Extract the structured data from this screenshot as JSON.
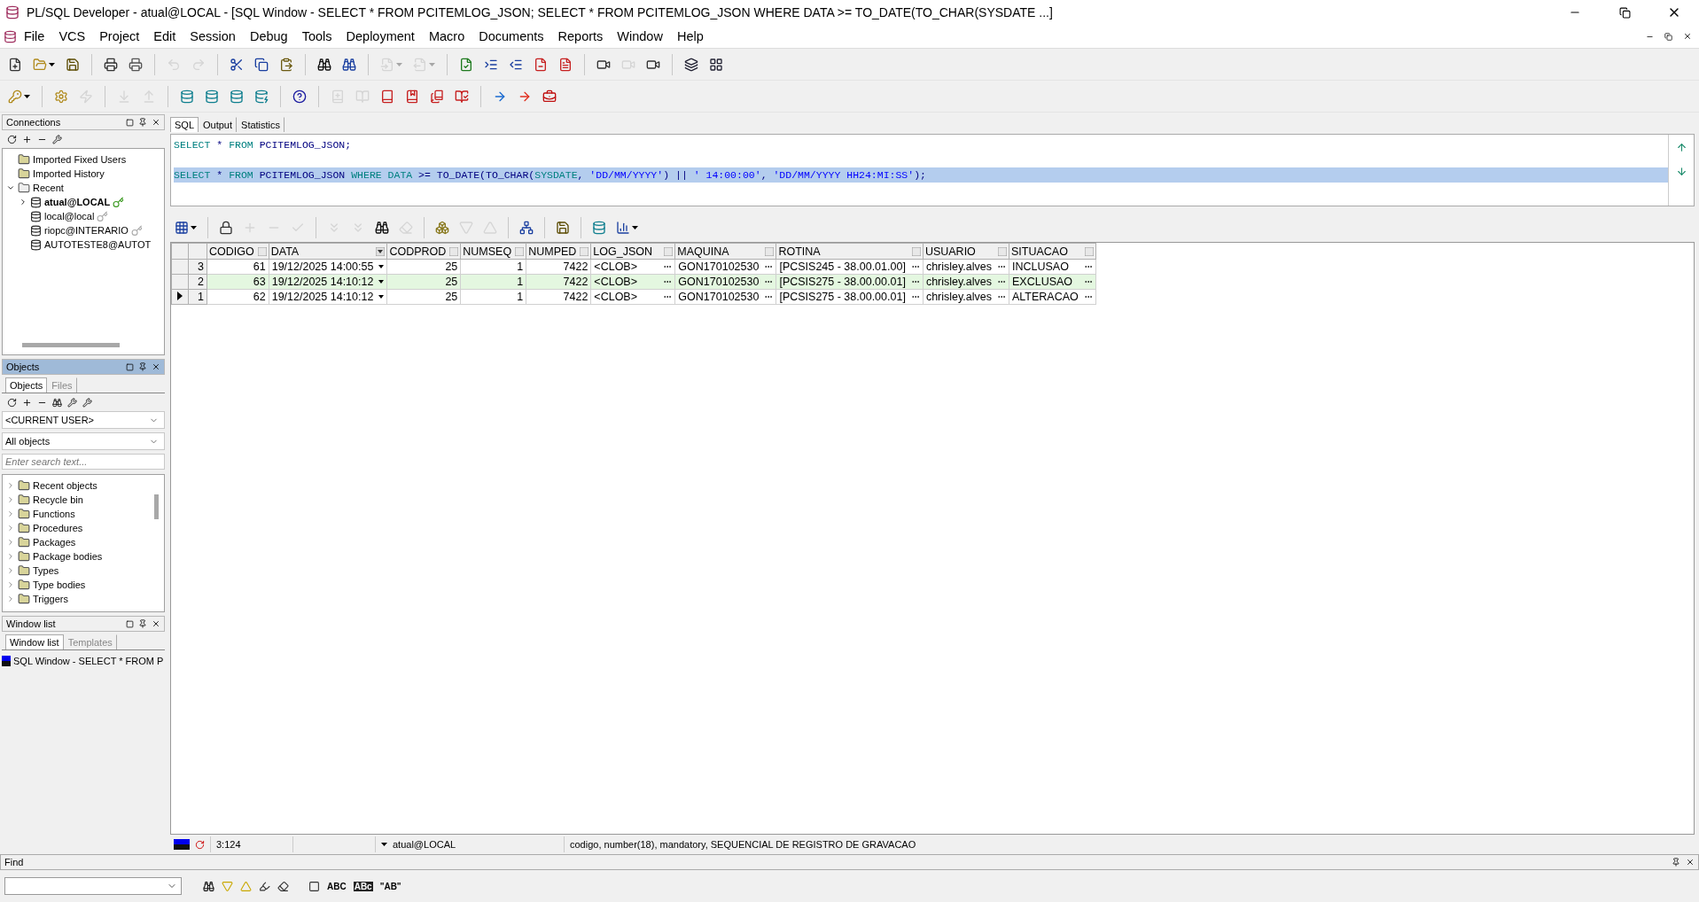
{
  "window": {
    "title": "PL/SQL Developer - atual@LOCAL - [SQL Window - SELECT * FROM PCITEMLOG_JSON; SELECT * FROM PCITEMLOG_JSON WHERE DATA >= TO_DATE(TO_CHAR(SYSDATE ...]"
  },
  "menu": [
    "File",
    "VCS",
    "Project",
    "Edit",
    "Session",
    "Debug",
    "Tools",
    "Deployment",
    "Macro",
    "Documents",
    "Reports",
    "Window",
    "Help"
  ],
  "toolbar_1": [
    {
      "kind": "new",
      "disabled": false
    },
    {
      "kind": "open",
      "disabled": false,
      "dropdown": true
    },
    {
      "kind": "save",
      "disabled": false
    },
    {
      "kind": "sep"
    },
    {
      "kind": "print",
      "disabled": false
    },
    {
      "kind": "print-setup",
      "disabled": false
    },
    {
      "kind": "sep"
    },
    {
      "kind": "undo",
      "disabled": true
    },
    {
      "kind": "redo",
      "disabled": true
    },
    {
      "kind": "sep"
    },
    {
      "kind": "cut",
      "disabled": false
    },
    {
      "kind": "copy",
      "disabled": false
    },
    {
      "kind": "paste",
      "disabled": false
    },
    {
      "kind": "sep"
    },
    {
      "kind": "find",
      "disabled": false
    },
    {
      "kind": "find-next",
      "disabled": false
    },
    {
      "kind": "sep"
    },
    {
      "kind": "back",
      "disabled": true,
      "dropdown": true
    },
    {
      "kind": "forward",
      "disabled": true,
      "dropdown": true
    },
    {
      "kind": "sep"
    },
    {
      "kind": "check",
      "disabled": false
    },
    {
      "kind": "indent",
      "disabled": false
    },
    {
      "kind": "unindent",
      "disabled": false
    },
    {
      "kind": "comment",
      "disabled": false
    },
    {
      "kind": "uncomment",
      "disabled": false
    },
    {
      "kind": "sep"
    },
    {
      "kind": "record",
      "disabled": false
    },
    {
      "kind": "play",
      "disabled": true
    },
    {
      "kind": "macro",
      "disabled": false
    },
    {
      "kind": "sep"
    },
    {
      "kind": "windows",
      "disabled": false
    },
    {
      "kind": "layout",
      "disabled": false
    }
  ],
  "toolbar_2": [
    {
      "kind": "key",
      "disabled": false,
      "dropdown": true
    },
    {
      "kind": "sep"
    },
    {
      "kind": "gear",
      "disabled": false
    },
    {
      "kind": "break",
      "disabled": true
    },
    {
      "kind": "sep"
    },
    {
      "kind": "import",
      "disabled": true
    },
    {
      "kind": "export",
      "disabled": true
    },
    {
      "kind": "sep"
    },
    {
      "kind": "db-bulb",
      "disabled": false
    },
    {
      "kind": "db-sql",
      "disabled": false
    },
    {
      "kind": "db-find",
      "disabled": false
    },
    {
      "kind": "db-close",
      "disabled": false
    },
    {
      "kind": "sep"
    },
    {
      "kind": "help",
      "disabled": false
    },
    {
      "kind": "sep"
    },
    {
      "kind": "book-new",
      "disabled": true
    },
    {
      "kind": "book-open",
      "disabled": true
    },
    {
      "kind": "book",
      "disabled": false
    },
    {
      "kind": "book-folder",
      "disabled": false
    },
    {
      "kind": "book-copy",
      "disabled": false
    },
    {
      "kind": "book-edit",
      "disabled": false
    },
    {
      "kind": "sep"
    },
    {
      "kind": "arrow-blue",
      "disabled": false
    },
    {
      "kind": "arrow-red",
      "disabled": false
    },
    {
      "kind": "toolbox",
      "disabled": false
    }
  ],
  "connections": {
    "title": "Connections",
    "tools": [
      {
        "kind": "refresh"
      },
      {
        "kind": "add"
      },
      {
        "kind": "remove"
      },
      {
        "kind": "filter"
      }
    ],
    "tree": [
      {
        "kind": "folder",
        "label": "Imported Fixed Users"
      },
      {
        "kind": "folder",
        "label": "Imported History"
      },
      {
        "kind": "recent",
        "label": "Recent",
        "expanded": true,
        "children": [
          {
            "kind": "connection",
            "label": "atual@LOCAL",
            "expanded": false,
            "active": true
          },
          {
            "kind": "connection",
            "label": "local@local",
            "active": false
          },
          {
            "kind": "connection",
            "label": "riopc@INTERARIO",
            "active": false
          },
          {
            "kind": "connection",
            "label": "AUTOTESTE8@AUTOT"
          }
        ]
      }
    ]
  },
  "objects": {
    "title": "Objects",
    "tabs": [
      {
        "label": "Objects",
        "selected": true
      },
      {
        "label": "Files",
        "selected": false
      }
    ],
    "tools": [
      {
        "kind": "refresh"
      },
      {
        "kind": "add"
      },
      {
        "kind": "remove"
      },
      {
        "kind": "find"
      },
      {
        "kind": "tool"
      },
      {
        "kind": "filter"
      }
    ],
    "owner": "<CURRENT USER>",
    "filter": "All objects",
    "search": {
      "placeholder": "Enter search text..."
    },
    "tree": [
      {
        "label": "Recent objects",
        "expanded": false
      },
      {
        "label": "Recycle bin",
        "expanded": false
      },
      {
        "label": "Functions",
        "expanded": false
      },
      {
        "label": "Procedures",
        "expanded": false
      },
      {
        "label": "Packages",
        "expanded": false
      },
      {
        "label": "Package bodies",
        "expanded": false
      },
      {
        "label": "Types",
        "expanded": false
      },
      {
        "label": "Type bodies",
        "expanded": false
      },
      {
        "label": "Triggers",
        "expanded": false
      }
    ]
  },
  "window_list": {
    "title": "Window list",
    "tabs": [
      {
        "label": "Window list",
        "selected": true
      },
      {
        "label": "Templates",
        "selected": false
      }
    ],
    "items": [
      "SQL Window - SELECT * FROM P"
    ]
  },
  "sql_tabs": [
    {
      "label": "SQL",
      "selected": true
    },
    {
      "label": "Output",
      "selected": false
    },
    {
      "label": "Statistics",
      "selected": false
    }
  ],
  "editor": {
    "lines": [
      {
        "selected": false,
        "tokens": [
          {
            "kind": "keyword",
            "text": "SELECT"
          },
          {
            "kind": "name",
            "text": " * "
          },
          {
            "kind": "keyword",
            "text": "FROM"
          },
          {
            "kind": "name",
            "text": " PCITEMLOG_JSON;"
          }
        ]
      },
      {
        "selected": false
      },
      {
        "selected": true,
        "tokens": [
          {
            "kind": "keyword",
            "text": "SELECT"
          },
          {
            "kind": "name",
            "text": " * "
          },
          {
            "kind": "keyword",
            "text": "FROM"
          },
          {
            "kind": "name",
            "text": " PCITEMLOG_JSON "
          },
          {
            "kind": "keyword",
            "text": "WHERE "
          },
          {
            "kind": "keyword",
            "text": "DATA"
          },
          {
            "kind": "name",
            "text": " >= TO_DATE(TO_CHAR("
          },
          {
            "kind": "keyword",
            "text": "SYSDATE"
          },
          {
            "kind": "name",
            "text": ", "
          },
          {
            "kind": "string",
            "text": "'DD/MM/YYYY'"
          },
          {
            "kind": "name",
            "text": ") || "
          },
          {
            "kind": "string",
            "text": "' 14:00:00'"
          },
          {
            "kind": "name",
            "text": ", "
          },
          {
            "kind": "string",
            "text": "'DD/MM/YYYY HH24:MI:SS'"
          },
          {
            "kind": "name",
            "text": ");"
          }
        ]
      }
    ]
  },
  "grid_toolbar": [
    {
      "kind": "grid",
      "disabled": false,
      "dropdown": true
    },
    {
      "kind": "sep"
    },
    {
      "kind": "lock",
      "disabled": false
    },
    {
      "kind": "add",
      "disabled": true
    },
    {
      "kind": "remove",
      "disabled": true
    },
    {
      "kind": "post",
      "disabled": true
    },
    {
      "kind": "sep"
    },
    {
      "kind": "next-page",
      "disabled": true
    },
    {
      "kind": "last-page",
      "disabled": true
    },
    {
      "kind": "find",
      "disabled": false
    },
    {
      "kind": "clear",
      "disabled": true
    },
    {
      "kind": "sep"
    },
    {
      "kind": "query",
      "disabled": false
    },
    {
      "kind": "down",
      "disabled": true
    },
    {
      "kind": "up",
      "disabled": true
    },
    {
      "kind": "sep"
    },
    {
      "kind": "tree",
      "disabled": false
    },
    {
      "kind": "sep"
    },
    {
      "kind": "save",
      "disabled": false
    },
    {
      "kind": "sep"
    },
    {
      "kind": "db-sql",
      "disabled": false
    },
    {
      "kind": "chart",
      "disabled": false,
      "dropdown": true
    }
  ],
  "table": {
    "columns": [
      {
        "label": "CODIGO",
        "kind": "number"
      },
      {
        "label": "DATA",
        "kind": "date"
      },
      {
        "label": "CODPROD",
        "kind": "number"
      },
      {
        "label": "NUMSEQ",
        "kind": "number"
      },
      {
        "label": "NUMPED",
        "kind": "number"
      },
      {
        "label": "LOG_JSON",
        "kind": "text"
      },
      {
        "label": "MAQUINA",
        "kind": "text"
      },
      {
        "label": "ROTINA",
        "kind": "text"
      },
      {
        "label": "USUARIO",
        "kind": "text"
      },
      {
        "label": "SITUACAO",
        "kind": "text"
      }
    ],
    "rows": [
      {
        "row": "3",
        "selected": false,
        "shaded": false,
        "cells": [
          "61",
          "19/12/2025 14:00:55",
          "25",
          "1",
          "7422",
          "<CLOB>",
          "GON170102530",
          "[PCSIS245 - 38.00.01.00]",
          "chrisley.alves",
          "INCLUSAO"
        ]
      },
      {
        "row": "2",
        "selected": false,
        "shaded": true,
        "cells": [
          "63",
          "19/12/2025 14:10:12",
          "25",
          "1",
          "7422",
          "<CLOB>",
          "GON170102530",
          "[PCSIS275 - 38.00.00.01]",
          "chrisley.alves",
          "EXCLUSAO"
        ]
      },
      {
        "row": "1",
        "selected": true,
        "shaded": false,
        "cells": [
          "62",
          "19/12/2025 14:10:12",
          "25",
          "1",
          "7422",
          "<CLOB>",
          "GON170102530",
          "[PCSIS275 - 38.00.00.01]",
          "chrisley.alves",
          "ALTERACAO"
        ]
      }
    ]
  },
  "status_bar": {
    "position": "3:124",
    "connection": "atual@LOCAL",
    "message": "codigo, number(18), mandatory, SEQUENCIAL DE REGISTRO DE GRAVACAO"
  },
  "find": {
    "title": "Find",
    "tools": [
      {
        "kind": "find"
      },
      {
        "kind": "down"
      },
      {
        "kind": "up"
      },
      {
        "kind": "highlight"
      },
      {
        "kind": "clear"
      },
      {
        "kind": "sep"
      },
      {
        "kind": "selection"
      },
      {
        "kind": "text",
        "label": "ABC"
      },
      {
        "kind": "text-boxed",
        "label": "ABc"
      },
      {
        "kind": "text",
        "label": "\"AB\""
      }
    ]
  }
}
